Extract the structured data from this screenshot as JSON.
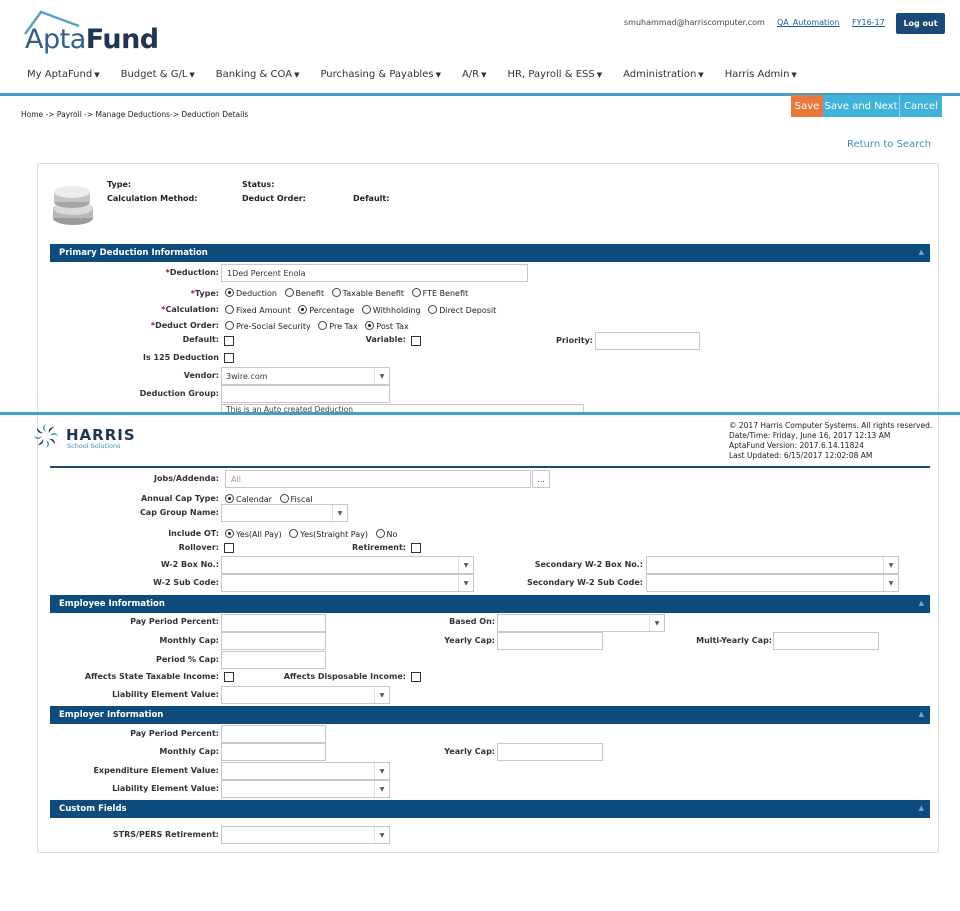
{
  "header": {
    "logo_light": "Apta",
    "logo_bold": "Fund",
    "user_email": "smuhammad@harriscomputer.com",
    "user_link": "QA_Automation",
    "fiscal_year": "FY16-17",
    "logout_label": "Log out"
  },
  "nav": [
    {
      "label": "My AptaFund"
    },
    {
      "label": "Budget & G/L"
    },
    {
      "label": "Banking & COA"
    },
    {
      "label": "Purchasing & Payables"
    },
    {
      "label": "A/R"
    },
    {
      "label": "HR, Payroll & ESS"
    },
    {
      "label": "Administration"
    },
    {
      "label": "Harris Admin"
    }
  ],
  "breadcrumb": "Home -> Payroll -> Manage Deductions-> Deduction Details",
  "actions": {
    "save": "Save",
    "save_next": "Save and Next",
    "cancel": "Cancel"
  },
  "return_search": "Return to Search",
  "summary": {
    "type_label": "Type:",
    "calc_label": "Calculation Method:",
    "status_label": "Status:",
    "order_label": "Deduct Order:",
    "default_label": "Default:"
  },
  "primary": {
    "title": "Primary Deduction Information",
    "deduction_label": "Deduction:",
    "deduction_value": "1Ded Percent Enola",
    "type_label": "Type:",
    "type_options": [
      "Deduction",
      "Benefit",
      "Taxable Benefit",
      "FTE Benefit"
    ],
    "type_selected": "Deduction",
    "calc_label": "Calculation:",
    "calc_options": [
      "Fixed Amount",
      "Percentage",
      "Withholding",
      "Direct Deposit"
    ],
    "calc_selected": "Percentage",
    "order_label": "Deduct Order:",
    "order_options": [
      "Pre-Social Security",
      "Pre Tax",
      "Post Tax"
    ],
    "order_selected": "Post Tax",
    "default_label": "Default:",
    "variable_label": "Variable:",
    "priority_label": "Priority:",
    "is125_label": "Is 125 Deduction",
    "vendor_label": "Vendor:",
    "vendor_value": "3wire.com",
    "group_label": "Deduction Group:",
    "description_partial": "This is an Auto created Deduction"
  },
  "footer": {
    "logo": "HARRIS",
    "logo_sub": "School Solutions",
    "copyright": "© 2017 Harris Computer Systems. All rights reserved.",
    "datetime": "Date/Time: Friday, June 16, 2017 12:13 AM",
    "version": "AptaFund Version: 2017.6.14.11824",
    "updated": "Last Updated: 6/15/2017 12:02:08 AM"
  },
  "lower": {
    "jobs_label": "Jobs/Addenda:",
    "jobs_value": "All",
    "jobs_btn": "...",
    "cap_type_label": "Annual Cap Type:",
    "cap_type_options": [
      "Calendar",
      "Fiscal"
    ],
    "cap_type_selected": "Calendar",
    "cap_group_label": "Cap Group Name:",
    "include_ot_label": "Include OT:",
    "include_ot_options": [
      "Yes(All Pay)",
      "Yes(Straight Pay)",
      "No"
    ],
    "include_ot_selected": "Yes(All Pay)",
    "rollover_label": "Rollover:",
    "retirement_label": "Retirement:",
    "w2_box_label": "W-2 Box No.:",
    "w2_sub_label": "W-2 Sub Code:",
    "sec_w2_box_label": "Secondary W-2 Box No.:",
    "sec_w2_sub_label": "Secondary W-2 Sub Code:"
  },
  "employee": {
    "title": "Employee Information",
    "pay_pct_label": "Pay Period Percent:",
    "based_on_label": "Based On:",
    "monthly_cap_label": "Monthly Cap:",
    "yearly_cap_label": "Yearly Cap:",
    "multi_yearly_label": "Multi-Yearly Cap:",
    "period_pct_label": "Period % Cap:",
    "state_taxable_label": "Affects State Taxable Income:",
    "disposable_label": "Affects Disposable Income:",
    "liability_label": "Liability Element Value:"
  },
  "employer": {
    "title": "Employer Information",
    "pay_pct_label": "Pay Period Percent:",
    "monthly_cap_label": "Monthly Cap:",
    "yearly_cap_label": "Yearly Cap:",
    "expenditure_label": "Expenditure Element Value:",
    "liability_label": "Liability Element Value:"
  },
  "custom": {
    "title": "Custom Fields",
    "strs_label": "STRS/PERS Retirement:"
  },
  "colors": {
    "brand": "#0e4c7e",
    "accent": "#3fb3d9",
    "save": "#e8793a"
  }
}
